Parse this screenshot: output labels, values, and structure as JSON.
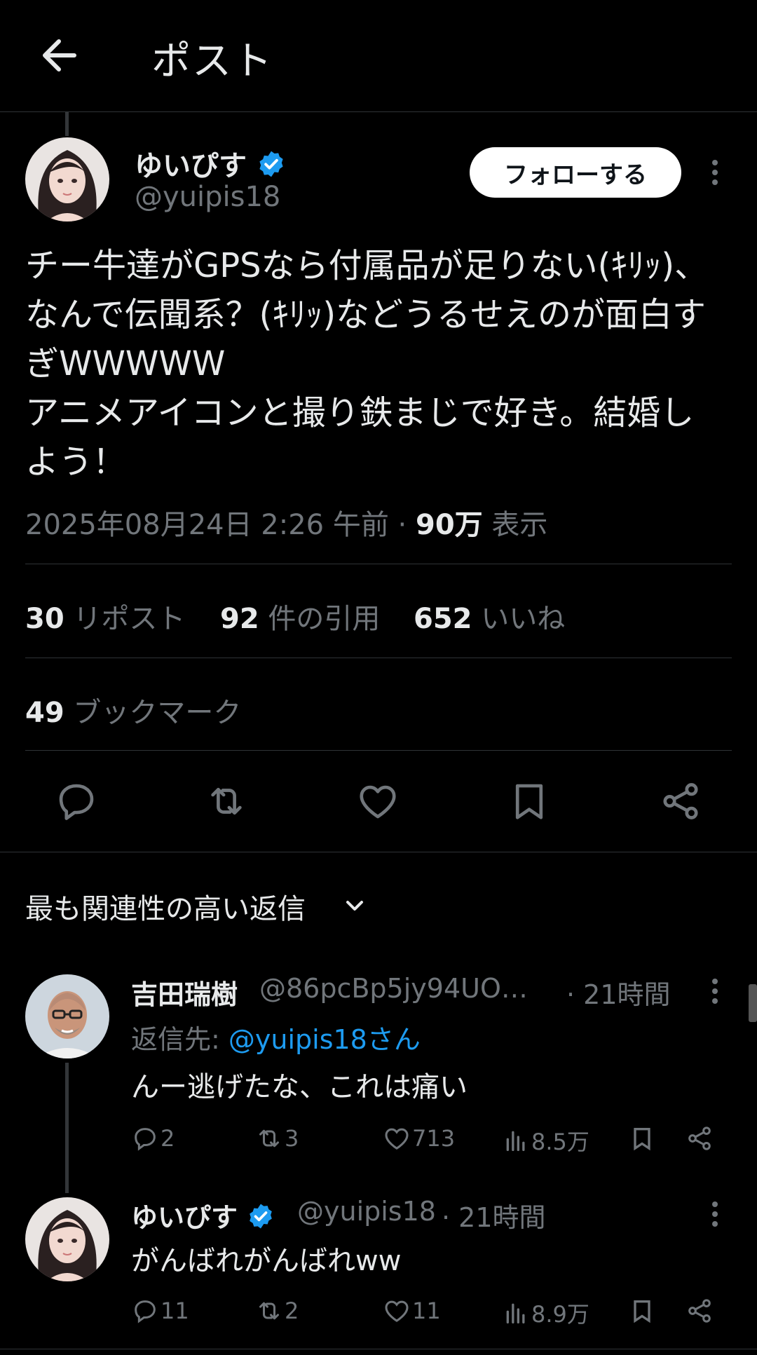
{
  "header": {
    "title": "ポスト"
  },
  "post": {
    "author_name": "ゆいぴす",
    "author_handle": "@yuipis18",
    "follow_label": "フォローする",
    "text": "チー牛達がGPSなら付属品が足りない(ｷﾘｯ)、なんで伝聞系？(ｷﾘｯ)などうるせえのが面白すぎWWWWW\nアニメアイコンと撮り鉄まじで好き。結婚しよう！",
    "timestamp": "2025年08月24日 2:26 午前 · ",
    "views_count": "90万",
    "views_label": " 表示",
    "reposts_count": "30",
    "reposts_label": " リポスト",
    "quotes_count": "92",
    "quotes_label": " 件の引用",
    "likes_count": "652",
    "likes_label": " いいね",
    "bookmarks_count": "49",
    "bookmarks_label": " ブックマーク"
  },
  "replies_sort": {
    "label": "最も関連性の高い返信"
  },
  "replies": [
    {
      "name": "吉田瑞樹",
      "handle": "@86pcBp5jy94UO…",
      "time": " · 21時間",
      "reply_to_prefix": "返信先: ",
      "reply_to_handle": "@yuipis18さん",
      "text": "んー逃げたな、これは痛い",
      "replies": "2",
      "reposts": "3",
      "likes": "713",
      "views": "8.5万"
    },
    {
      "name": "ゆいぴす",
      "handle": "@yuipis18",
      "time": " · 21時間",
      "text": "がんばれがんばれww",
      "replies": "11",
      "reposts": "2",
      "likes": "11",
      "views": "8.9万"
    }
  ],
  "colors": {
    "background": "#000000",
    "accent": "#1d9bf0",
    "muted": "#71767b",
    "text": "#e7e9ea"
  }
}
